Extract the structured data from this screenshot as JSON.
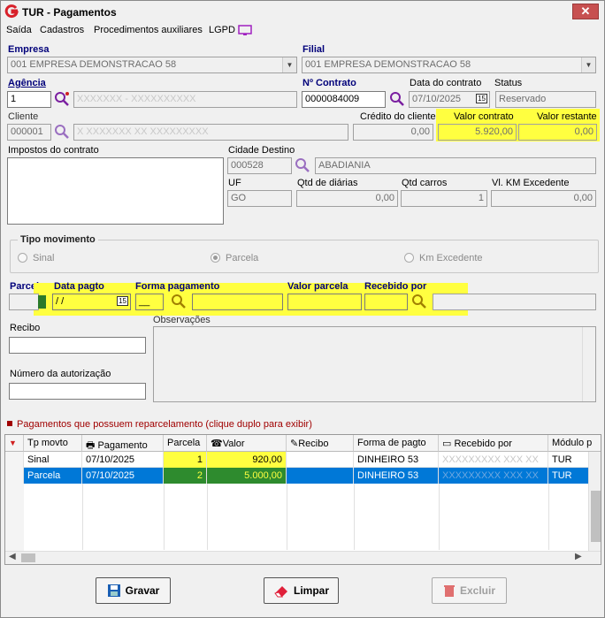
{
  "window": {
    "title": "TUR - Pagamentos",
    "close_label": "✕"
  },
  "menu": [
    "Saída",
    "Cadastros",
    "Procedimentos auxiliares",
    "LGPD"
  ],
  "empresa": {
    "label": "Empresa",
    "value": "001 EMPRESA DEMONSTRACAO 58"
  },
  "filial": {
    "label": "Filial",
    "value": "001 EMPRESA DEMONSTRACAO 58"
  },
  "agencia": {
    "label": "Agência",
    "code": "1",
    "name": "XXXXXXX - XXXXXXXXXX"
  },
  "contrato": {
    "label": "Nº Contrato",
    "value": "0000084009"
  },
  "data_contrato": {
    "label": "Data do contrato",
    "value": "07/10/2025",
    "cal": "15"
  },
  "status": {
    "label": "Status",
    "value": "Reservado"
  },
  "cliente": {
    "label": "Cliente",
    "code": "000001",
    "name": "X XXXXXXX XX XXXXXXXXX"
  },
  "credito": {
    "label": "Crédito do cliente",
    "value": "0,00"
  },
  "valor_contrato": {
    "label": "Valor contrato",
    "value": "5.920,00"
  },
  "valor_restante": {
    "label": "Valor restante",
    "value": "0,00"
  },
  "impostos": {
    "label": "Impostos do contrato"
  },
  "cidade": {
    "label": "Cidade Destino",
    "code": "000528",
    "name": "ABADIANIA"
  },
  "uf": {
    "label": "UF",
    "value": "GO"
  },
  "qtd_diarias": {
    "label": "Qtd de diárias",
    "value": "0,00"
  },
  "qtd_carros": {
    "label": "Qtd carros",
    "value": "1"
  },
  "vl_km": {
    "label": "Vl. KM Excedente",
    "value": "0,00"
  },
  "tipo_movimento": {
    "title": "Tipo movimento",
    "options": [
      "Sinal",
      "Parcela",
      "Km Excedente"
    ],
    "selected": "Parcela"
  },
  "entry": {
    "parcela": "Parcela",
    "data_pagto": "Data pagto",
    "data_value": " / /",
    "cal": "15",
    "forma": "Forma pagamento",
    "forma_value": "__",
    "valor_parcela": "Valor parcela",
    "recebido_por": "Recebido por"
  },
  "recibo": {
    "label": "Recibo"
  },
  "observacoes": {
    "label": "Observações"
  },
  "autorizacao": {
    "label": "Número da autorização"
  },
  "reparcel_note": "Pagamentos que possuem reparcelamento (clique duplo para exibir)",
  "colors": {
    "highlight": "#ffff40",
    "selected_row": "#0078d7",
    "label_blue": "#00007a",
    "note_red": "#a00000"
  },
  "grid": {
    "columns": [
      "Tp movto",
      "Pagamento",
      "Parcela",
      "Valor",
      "Recibo",
      "Forma de pagto",
      "Recebido por",
      "Módulo p"
    ],
    "rows": [
      {
        "tipo": "Sinal",
        "pagamento": "07/10/2025",
        "parcela": "1",
        "valor": "920,00",
        "recibo": "",
        "forma": "DINHEIRO 53",
        "recebido": "XXXXXXXXX XXX XX",
        "modulo": "TUR"
      },
      {
        "tipo": "Parcela",
        "pagamento": "07/10/2025",
        "parcela": "2",
        "valor": "5.000,00",
        "recibo": "",
        "forma": "DINHEIRO 53",
        "recebido": "XXXXXXXXX XXX XX",
        "modulo": "TUR"
      }
    ]
  },
  "buttons": {
    "gravar": "Gravar",
    "limpar": "Limpar",
    "excluir": "Excluir"
  }
}
